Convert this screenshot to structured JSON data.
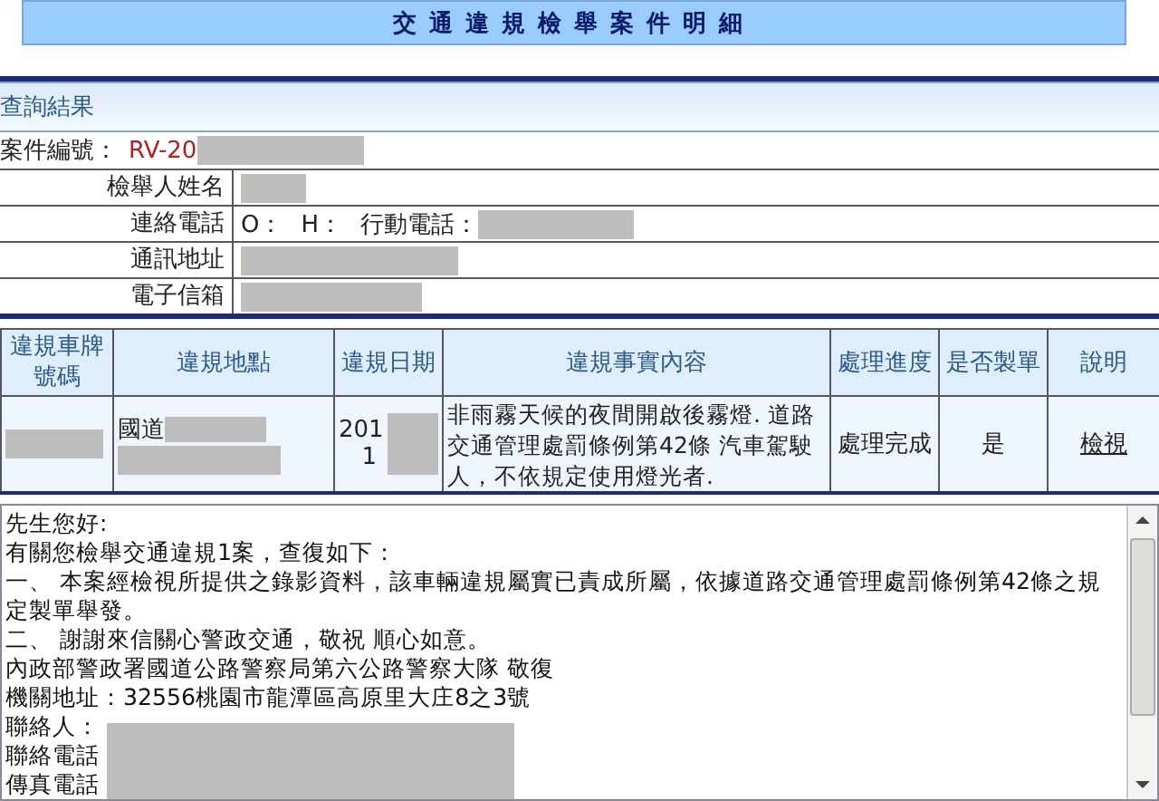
{
  "page_title": "交通違規檢舉案件明細",
  "panel_title": "查詢結果",
  "case_number": {
    "label": "案件編號：",
    "value": "RV-20"
  },
  "reporter_rows": [
    {
      "label": "檢舉人姓名",
      "parts": []
    },
    {
      "label": "連絡電話",
      "parts": [
        "O：",
        "H：",
        "行動電話："
      ]
    },
    {
      "label": "通訊地址",
      "parts": []
    },
    {
      "label": "電子信箱",
      "parts": []
    }
  ],
  "table": {
    "columns": [
      "違規車牌號碼",
      "違規地點",
      "違規日期",
      "違規事實內容",
      "處理進度",
      "是否製單",
      "說明"
    ],
    "rows": [
      {
        "location": "國道",
        "date": [
          "201",
          "1"
        ],
        "content": "非雨霧天候的夜間開啟後霧燈. 道路交通管理處罰條例第42條 汽車駕駛人，不依規定使用燈光者.",
        "progress": "處理完成",
        "billed": "是",
        "link": "檢視"
      }
    ]
  },
  "reply_lines": [
    "先生您好:",
    "有關您檢舉交通違規1案，查復如下：",
    "一、 本案經檢視所提供之錄影資料，該車輛違規屬實已責成所屬，依據道路交通管理處罰條例第42條之規定製單舉發。",
    "二、 謝謝來信關心警政交通，敬祝 順心如意。",
    "內政部警政署國道公路警察局第六公路警察大隊 敬復",
    "機關地址：32556桃園市龍潭區高原里大庄8之3號",
    "聯絡人：",
    "聯絡電話",
    "傳真電話"
  ]
}
